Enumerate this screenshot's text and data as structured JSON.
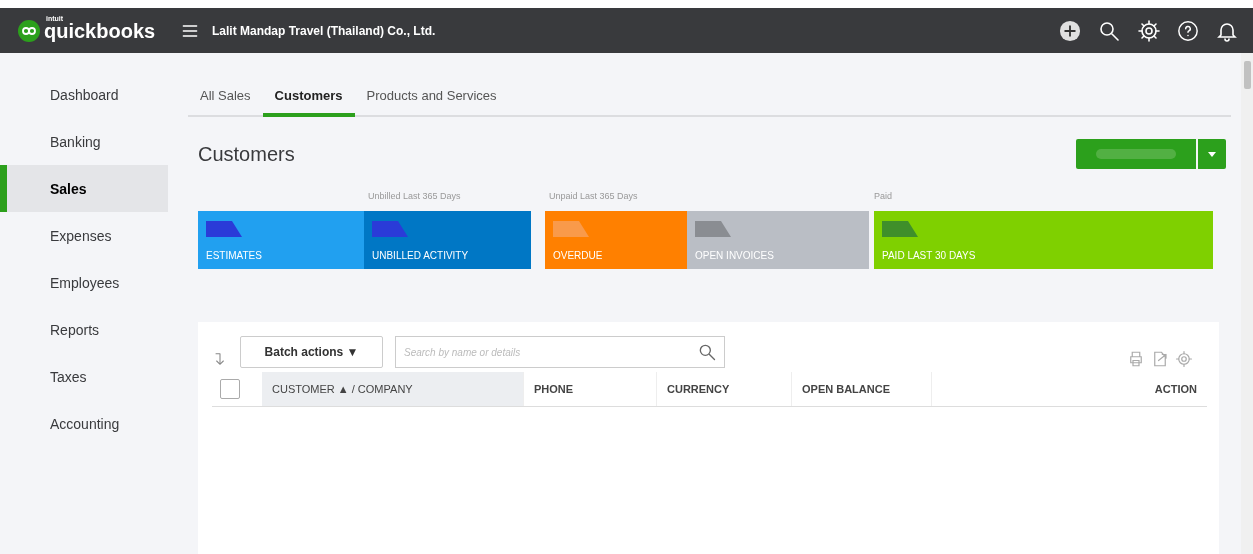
{
  "header": {
    "logo_small": "intuit",
    "logo": "quickbooks",
    "company": "Lalit Mandap Travel (Thailand) Co., Ltd."
  },
  "sidebar": {
    "items": [
      {
        "label": "Dashboard",
        "selected": false
      },
      {
        "label": "Banking",
        "selected": false
      },
      {
        "label": "Sales",
        "selected": true
      },
      {
        "label": "Expenses",
        "selected": false
      },
      {
        "label": "Employees",
        "selected": false
      },
      {
        "label": "Reports",
        "selected": false
      },
      {
        "label": "Taxes",
        "selected": false
      },
      {
        "label": "Accounting",
        "selected": false
      }
    ]
  },
  "tabs": [
    {
      "label": "All Sales",
      "selected": false
    },
    {
      "label": "Customers",
      "selected": true
    },
    {
      "label": "Products and Services",
      "selected": false
    }
  ],
  "page_title": "Customers",
  "summary_cards": [
    {
      "kind": "estimates",
      "label": "ESTIMATES"
    },
    {
      "kind": "unbilled",
      "caption": "Unbilled Last 365 Days",
      "label": "UNBILLED ACTIVITY"
    },
    {
      "kind": "overdue",
      "caption": "Unpaid Last 365 Days",
      "label": "OVERDUE"
    },
    {
      "kind": "open",
      "label": "OPEN INVOICES"
    },
    {
      "kind": "paid",
      "caption": "Paid",
      "label": "PAID LAST 30 DAYS"
    }
  ],
  "table": {
    "batch_button": "Batch actions ▼",
    "search": {
      "placeholder": "Search by name or details"
    },
    "select_all": {
      "checked": false
    },
    "columns": [
      "CUSTOMER ▲ / COMPANY",
      "PHONE",
      "CURRENCY",
      "OPEN BALANCE",
      "ACTION"
    ]
  }
}
